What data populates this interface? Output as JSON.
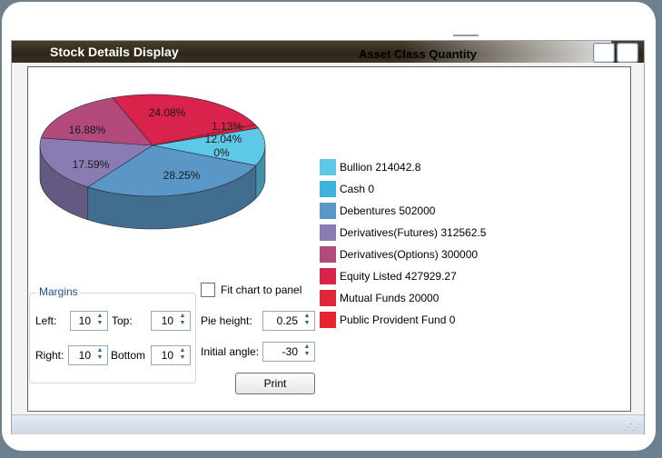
{
  "window": {
    "title": "Stock Details Display"
  },
  "chart_data": {
    "type": "pie",
    "title": "Asset Class  Quantity",
    "slices": [
      {
        "label": "Bullion",
        "value": 214042.8,
        "percent": "12.04%",
        "color": "#5ec9e6"
      },
      {
        "label": "Cash",
        "value": 0,
        "percent": "0%",
        "color": "#3fb3e0"
      },
      {
        "label": "Debentures",
        "value": 502000,
        "percent": "28.25%",
        "color": "#5a97c7"
      },
      {
        "label": "Derivatives(Futures)",
        "value": 312562.5,
        "percent": "17.59%",
        "color": "#8a7bb3"
      },
      {
        "label": "Derivatives(Options)",
        "value": 300000,
        "percent": "16.88%",
        "color": "#b24a7c"
      },
      {
        "label": "Equity Listed",
        "value": 427929.27,
        "percent": "24.08%",
        "color": "#d9234b"
      },
      {
        "label": "Mutual Funds",
        "value": 20000,
        "percent": "1.13%",
        "color": "#e0263a"
      },
      {
        "label": "Public Provident Fund",
        "value": 0,
        "percent": "0%",
        "color": "#e8242e"
      }
    ],
    "legend": [
      {
        "text": "Bullion  214042.8",
        "color": "#5ec9e6"
      },
      {
        "text": "Cash  0",
        "color": "#3fb3e0"
      },
      {
        "text": "Debentures  502000",
        "color": "#5a97c7"
      },
      {
        "text": "Derivatives(Futures)  312562.5",
        "color": "#8a7bb3"
      },
      {
        "text": "Derivatives(Options)  300000",
        "color": "#b24a7c"
      },
      {
        "text": "Equity Listed  427929.27",
        "color": "#d9234b"
      },
      {
        "text": "Mutual Funds  20000",
        "color": "#e0263a"
      },
      {
        "text": "Public Provident Fund  0",
        "color": "#e8242e"
      }
    ],
    "legend_position": "right"
  },
  "controls": {
    "margins_title": "Margins",
    "left_label": "Left:",
    "left_value": "10",
    "top_label": "Top:",
    "top_value": "10",
    "right_label": "Right:",
    "right_value": "10",
    "bottom_label": "Bottom",
    "bottom_value": "10",
    "fit_label": "Fit chart to panel",
    "pie_height_label": "Pie height:",
    "pie_height_value": "0.25",
    "initial_angle_label": "Initial angle:",
    "initial_angle_value": "-30",
    "print_label": "Print"
  }
}
